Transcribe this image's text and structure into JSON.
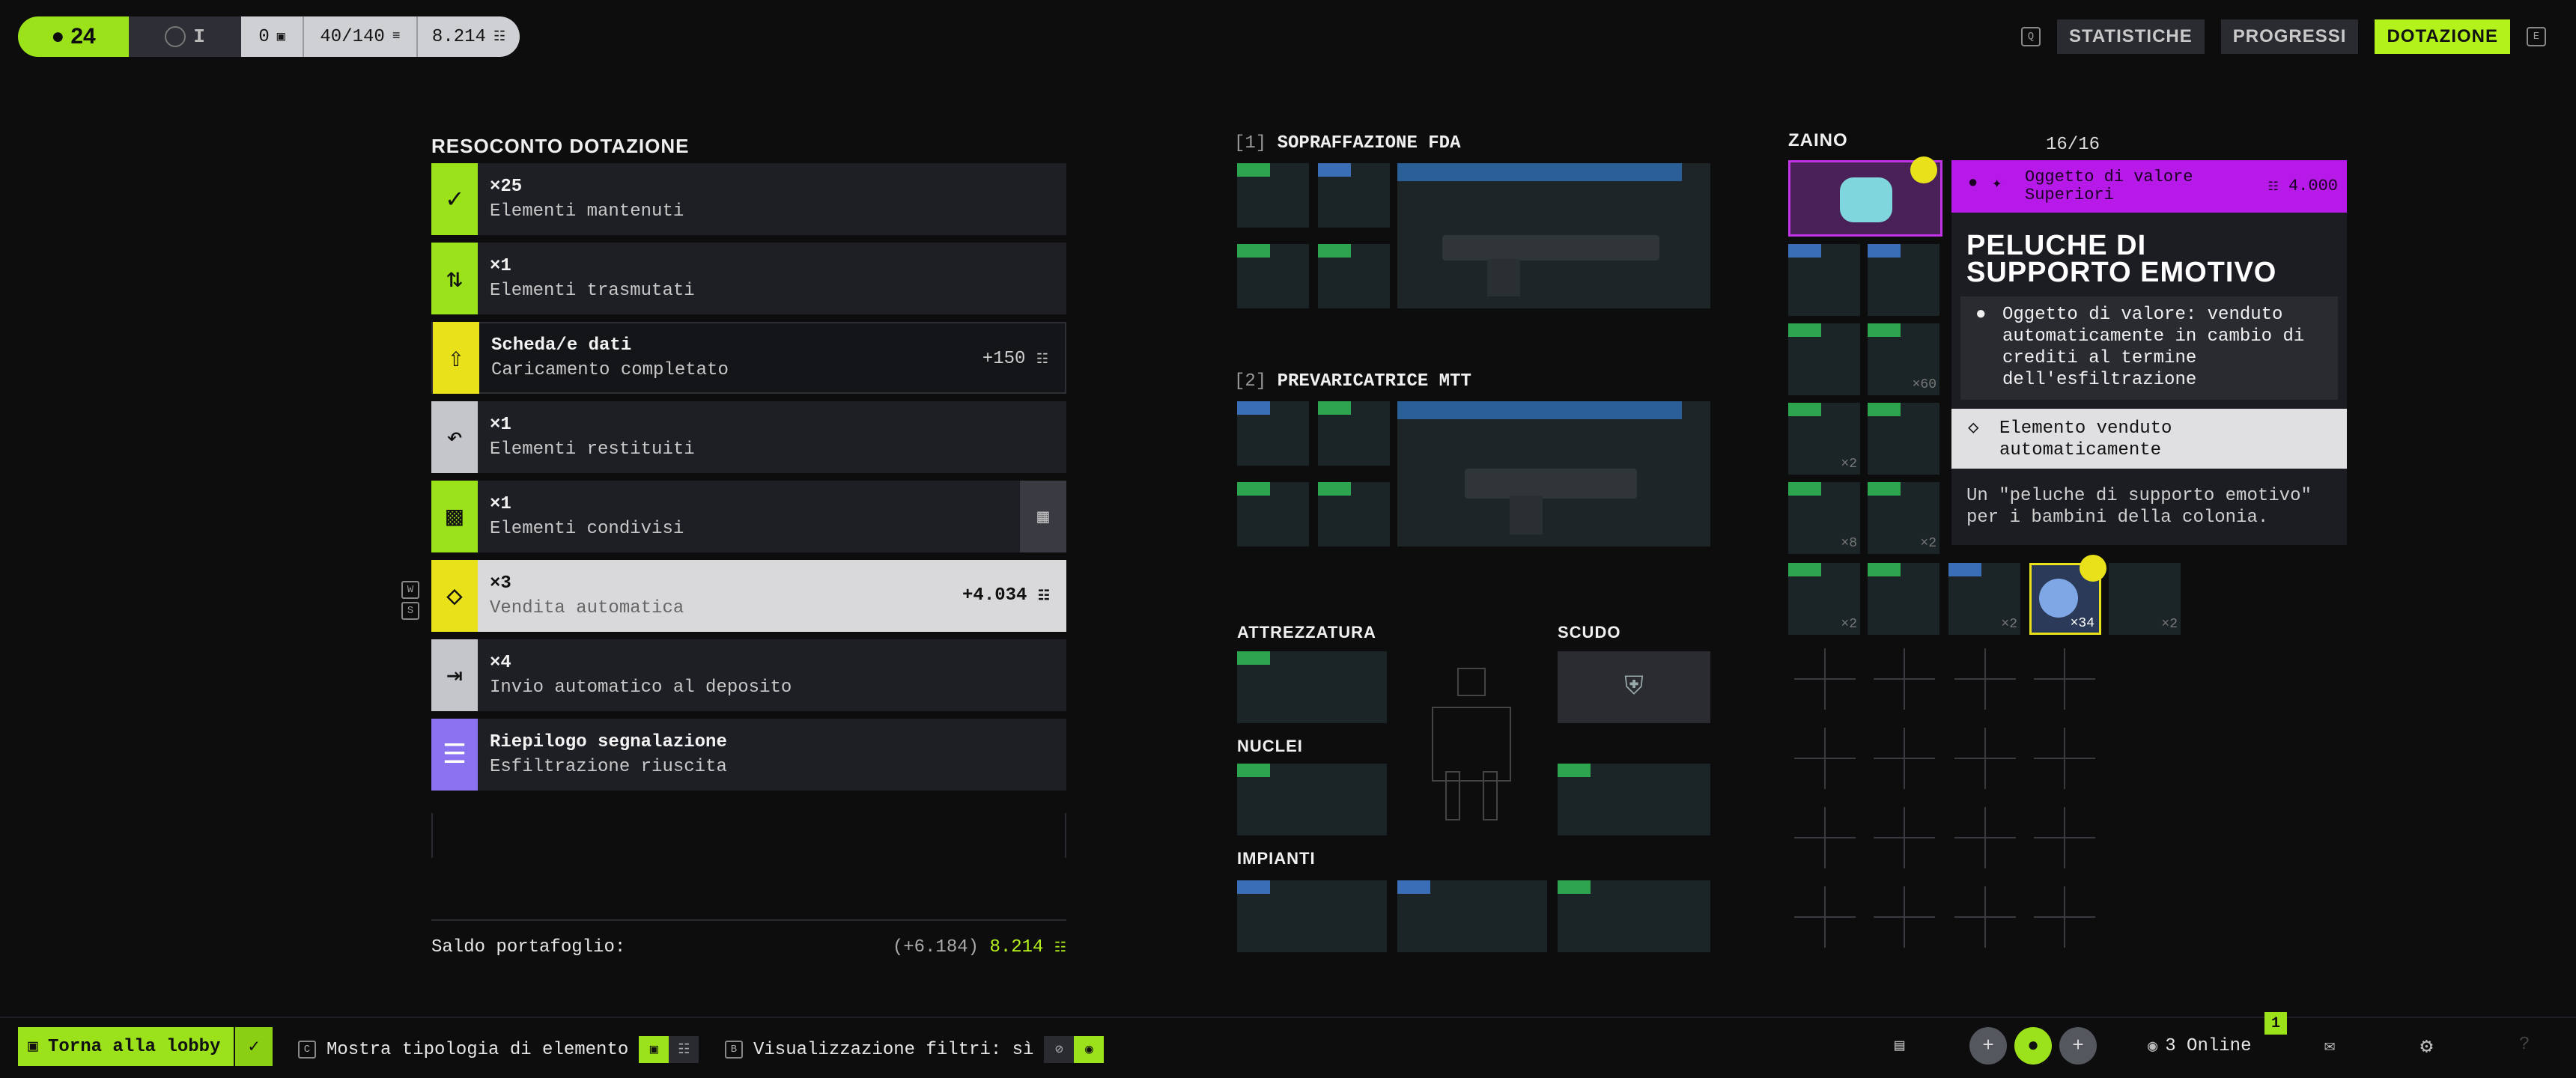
{
  "topbar": {
    "level": "24",
    "rank": "I",
    "counter_a": "0",
    "capacity": "40/140",
    "credits": "8.214",
    "tabs": [
      "STATISTICHE",
      "PROGRESSI",
      "DOTAZIONE"
    ],
    "active_tab": "DOTAZIONE"
  },
  "summary": {
    "title": "RESOCONTO DOTAZIONE",
    "rows": [
      {
        "l1": "×25",
        "l2": "Elementi mantenuti",
        "right": "",
        "icon": "check-icon",
        "color": "#9be21b"
      },
      {
        "l1": "×1",
        "l2": "Elementi trasmutati",
        "right": "",
        "icon": "transmute-icon",
        "color": "#9be21b"
      },
      {
        "l1": "Scheda/e dati",
        "l2": "Caricamento completato",
        "right": "+150",
        "icon": "upload-icon",
        "color": "#e9e21a"
      },
      {
        "l1": "×1",
        "l2": "Elementi restituiti",
        "right": "",
        "icon": "return-icon",
        "color": "#c5c6cb"
      },
      {
        "l1": "×1",
        "l2": "Elementi condivisi",
        "right": "",
        "icon": "share-icon",
        "color": "#9be21b"
      },
      {
        "l1": "×3",
        "l2": "Vendita automatica",
        "right": "+4.034",
        "icon": "autosell-icon",
        "color": "#e9e21a"
      },
      {
        "l1": "×4",
        "l2": "Invio automatico al deposito",
        "right": "",
        "icon": "deposit-icon",
        "color": "#c5c6cb"
      },
      {
        "l1": "Riepilogo segnalazione",
        "l2": "Esfiltrazione riuscita",
        "right": "",
        "icon": "list-icon",
        "color": "#8a72f0"
      }
    ],
    "wallet_label": "Saldo portafoglio:",
    "wallet_delta": "(+6.184)",
    "wallet_total": "8.214"
  },
  "weapons": {
    "w1_num": "[1]",
    "w1_name": "SOPRAFFAZIONE FDA",
    "w2_num": "[2]",
    "w2_name": "PREVARICATRICE MTT"
  },
  "equipment": {
    "gear": "ATTREZZATURA",
    "shield": "SCUDO",
    "cores": "NUCLEI",
    "implants": "IMPIANTI"
  },
  "backpack": {
    "title": "ZAINO",
    "count": "16/16",
    "stack_badges": [
      "×2",
      "×8",
      "×2",
      "×2",
      "×2",
      "×34",
      "×2",
      "×60"
    ]
  },
  "tooltip": {
    "category": "Oggetto di valore",
    "rarity": "Superiori",
    "price": "4.000",
    "title_line1": "PELUCHE DI",
    "title_line2": "SUPPORTO EMOTIVO",
    "info": "Oggetto di valore: venduto automaticamente in cambio di crediti al termine dell'esfiltrazione",
    "sold": "Elemento venduto automaticamente",
    "desc": "Un \"peluche di supporto emotivo\" per i bambini della colonia."
  },
  "bottom": {
    "lobby": "Torna alla lobby",
    "key_c": "C",
    "show_type": "Mostra tipologia di elemento",
    "key_b": "B",
    "filters": "Visualizzazione filtri: sì",
    "online": "3 Online",
    "notify": "1"
  },
  "colors": {
    "lime": "#9be21b",
    "yellow": "#e9e21a",
    "purple": "#8a72f0",
    "magenta": "#b619e8"
  }
}
